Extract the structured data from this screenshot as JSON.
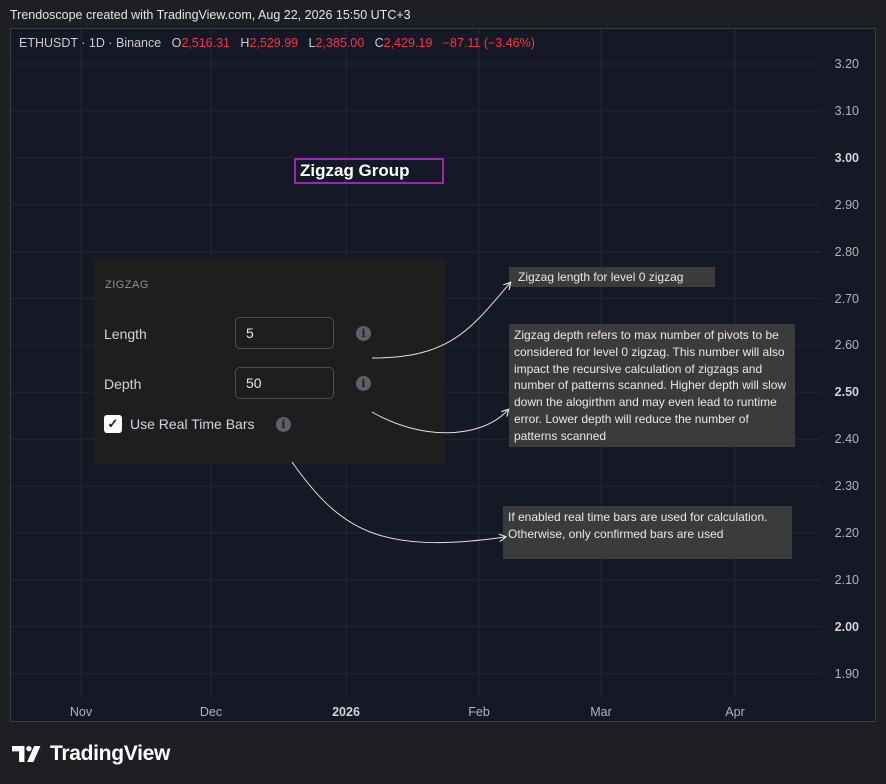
{
  "header": {
    "text": "Trendoscope created with TradingView.com, Aug 22, 2026 15:50 UTC+3"
  },
  "symbol": {
    "name": "ETHUSDT · 1D · Binance",
    "o_key": "O",
    "o_val": "2,516.31",
    "h_key": "H",
    "h_val": "2,529.99",
    "l_key": "L",
    "l_val": "2,385.00",
    "c_key": "C",
    "c_val": "2,429.19",
    "change": "−87.11 (−3.46%)",
    "change_color": "#f23645"
  },
  "y_axis": {
    "labels": [
      "3.20",
      "3.10",
      "3.00",
      "2.90",
      "2.80",
      "2.70",
      "2.60",
      "2.50",
      "2.40",
      "2.30",
      "2.20",
      "2.10",
      "2.00",
      "1.90"
    ],
    "bold": [
      "3.00",
      "2.50",
      "2.00"
    ]
  },
  "x_axis": {
    "labels": [
      "Nov",
      "Dec",
      "2026",
      "Feb",
      "Mar",
      "Apr"
    ],
    "bold": [
      "2026"
    ]
  },
  "group_title": "Zigzag Group",
  "panel": {
    "heading": "ZIGZAG",
    "length_label": "Length",
    "length_value": "5",
    "depth_label": "Depth",
    "depth_value": "50",
    "realtime_label": "Use Real Time Bars",
    "realtime_checked": true
  },
  "tooltips": {
    "length": "Zigzag length for level 0 zigzag",
    "depth": "Zigzag depth refers to max number of pivots to be considered for level 0 zigzag. This number will also impact the recursive calculation of zigzags and number of patterns scanned. Higher depth will slow down the alogirthm and may even lead to runtime error. Lower depth will reduce the number of patterns scanned",
    "realtime": "If enabled real time bars are used for calculation. Otherwise, only confirmed bars are used"
  },
  "footer": {
    "brand": "TradingView"
  }
}
